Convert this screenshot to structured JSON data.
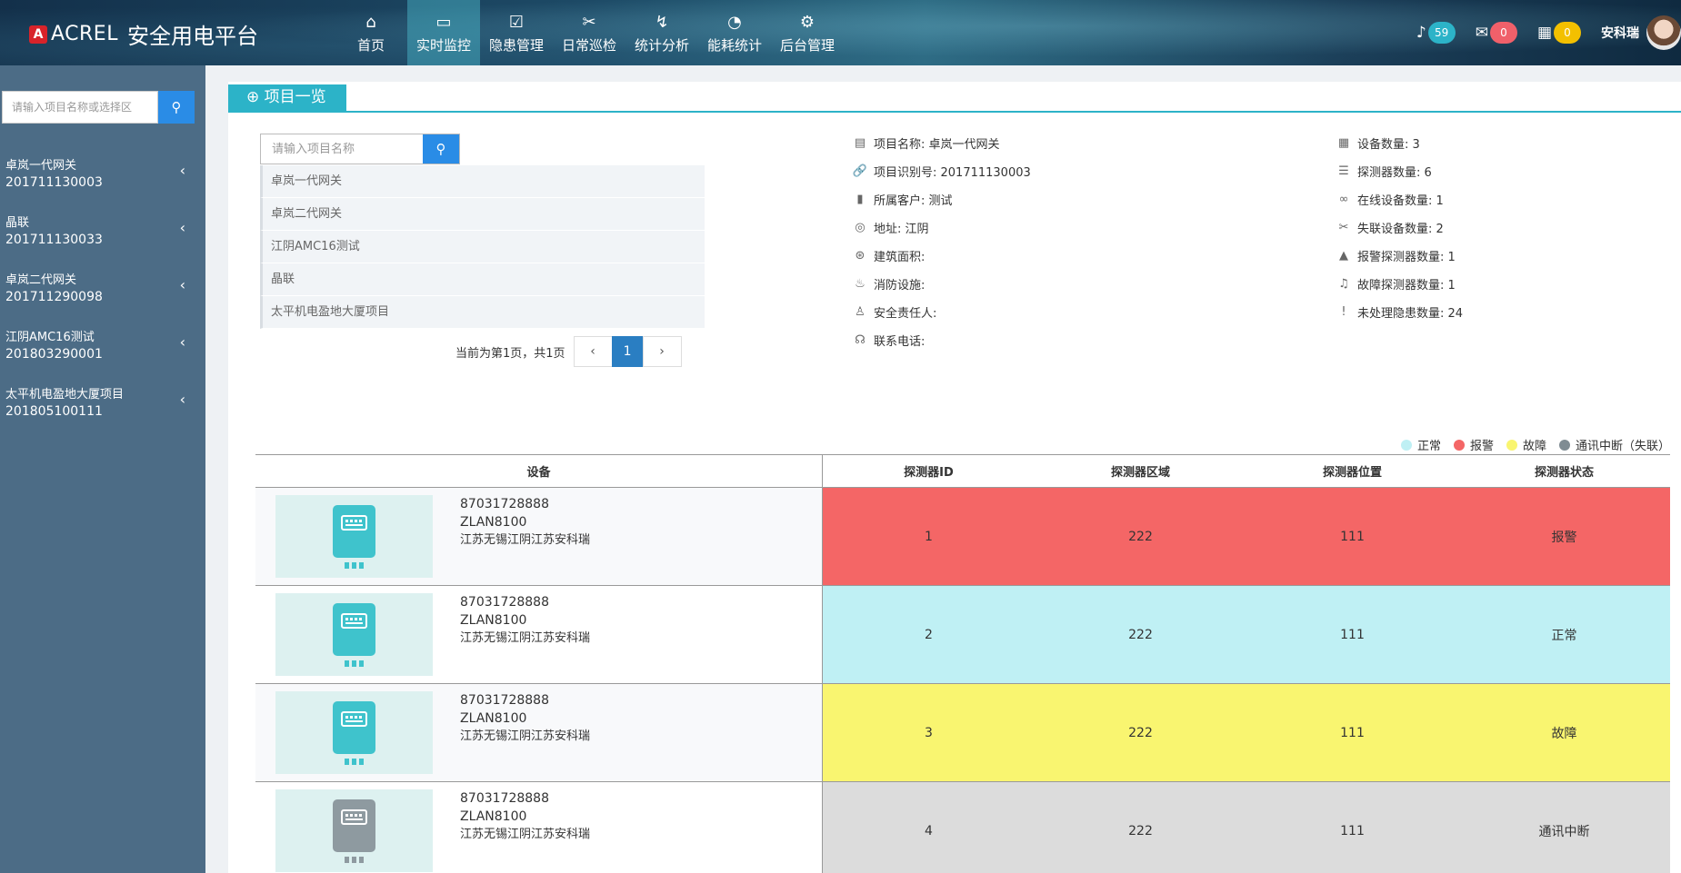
{
  "header": {
    "brand": "ACREL",
    "title": "安全用电平台",
    "nav": [
      {
        "label": "首页",
        "icon": "⌂",
        "icon_name": "home-icon",
        "active": false
      },
      {
        "label": "实时监控",
        "icon": "▭",
        "icon_name": "monitor-icon",
        "active": true
      },
      {
        "label": "隐患管理",
        "icon": "☑",
        "icon_name": "clipboard-check-icon",
        "active": false
      },
      {
        "label": "日常巡检",
        "icon": "✂",
        "icon_name": "tools-icon",
        "active": false
      },
      {
        "label": "统计分析",
        "icon": "↯",
        "icon_name": "analysis-icon",
        "active": false
      },
      {
        "label": "能耗统计",
        "icon": "◔",
        "icon_name": "pie-chart-icon",
        "active": false
      },
      {
        "label": "后台管理",
        "icon": "⚙",
        "icon_name": "gear-icon",
        "active": false
      }
    ],
    "bell_count": "59",
    "mail_count": "0",
    "task_count": "0",
    "user_name": "安科瑞"
  },
  "sidebar": {
    "search_placeholder": "请输入项目名称或选择区",
    "items": [
      {
        "name": "卓岚一代网关",
        "code": "201711130003"
      },
      {
        "name": "晶联",
        "code": "201711130033"
      },
      {
        "name": "卓岚二代网关",
        "code": "201711290098"
      },
      {
        "name": "江阴AMC16测试",
        "code": "201803290001"
      },
      {
        "name": "太平机电盈地大厦项目",
        "code": "201805100111"
      }
    ]
  },
  "main": {
    "tab_label": "项目一览",
    "project_search_placeholder": "请输入项目名称",
    "projects": [
      "卓岚一代网关",
      "卓岚二代网关",
      "江阴AMC16测试",
      "晶联",
      "太平机电盈地大厦项目"
    ],
    "pager": {
      "text": "当前为第1页，共1页",
      "prev": "‹",
      "current": "1",
      "next": "›"
    },
    "info_left": [
      {
        "label": "项目名称: 卓岚一代网关",
        "icon": "▤",
        "icon_name": "list-icon"
      },
      {
        "label": "项目识别号: 201711130003",
        "icon": "🔗",
        "icon_name": "link-icon"
      },
      {
        "label": "所属客户: 测试",
        "icon": "▮",
        "icon_name": "customer-icon"
      },
      {
        "label": "地址: 江阴",
        "icon": "◎",
        "icon_name": "location-icon"
      },
      {
        "label": "建筑面积:",
        "icon": "⊛",
        "icon_name": "area-icon"
      },
      {
        "label": "消防设施:",
        "icon": "♨",
        "icon_name": "fire-icon"
      },
      {
        "label": "安全责任人:",
        "icon": "♙",
        "icon_name": "person-icon"
      },
      {
        "label": "联系电话:",
        "icon": "☊",
        "icon_name": "headset-icon"
      }
    ],
    "info_right": [
      {
        "label": "设备数量: 3",
        "icon": "▦",
        "icon_name": "grid-icon"
      },
      {
        "label": "探测器数量: 6",
        "icon": "☰",
        "icon_name": "sliders-icon"
      },
      {
        "label": "在线设备数量: 1",
        "icon": "∞",
        "icon_name": "chain-icon"
      },
      {
        "label": "失联设备数量: 2",
        "icon": "✂",
        "icon_name": "broken-link-icon"
      },
      {
        "label": "报警探测器数量: 1",
        "icon": "▲",
        "icon_name": "warning-icon"
      },
      {
        "label": "故障探测器数量: 1",
        "icon": "♫",
        "icon_name": "bell-icon"
      },
      {
        "label": "未处理隐患数量: 24",
        "icon": "!",
        "icon_name": "exclamation-icon"
      }
    ],
    "legend": [
      {
        "label": "正常",
        "color": "#bff0f4"
      },
      {
        "label": "报警",
        "color": "#f46666"
      },
      {
        "label": "故障",
        "color": "#f9f570"
      },
      {
        "label": "通讯中断（失联）",
        "color": "#7f8c93"
      }
    ],
    "table": {
      "headers": {
        "device": "设备",
        "id": "探测器ID",
        "area": "探测器区域",
        "position": "探测器位置",
        "status": "探测器状态"
      },
      "rows": [
        {
          "serial": "87031728888",
          "model": "ZLAN8100",
          "address": "江苏无锡江阴江苏安科瑞",
          "id": "1",
          "area": "222",
          "position": "111",
          "status": "报警",
          "state": "alarm",
          "online": true
        },
        {
          "serial": "87031728888",
          "model": "ZLAN8100",
          "address": "江苏无锡江阴江苏安科瑞",
          "id": "2",
          "area": "222",
          "position": "111",
          "status": "正常",
          "state": "normal",
          "online": true
        },
        {
          "serial": "87031728888",
          "model": "ZLAN8100",
          "address": "江苏无锡江阴江苏安科瑞",
          "id": "3",
          "area": "222",
          "position": "111",
          "status": "故障",
          "state": "fault",
          "online": true
        },
        {
          "serial": "87031728888",
          "model": "ZLAN8100",
          "address": "江苏无锡江阴江苏安科瑞",
          "id": "4",
          "area": "222",
          "position": "111",
          "status": "通讯中断",
          "state": "offline",
          "online": false
        }
      ]
    }
  }
}
